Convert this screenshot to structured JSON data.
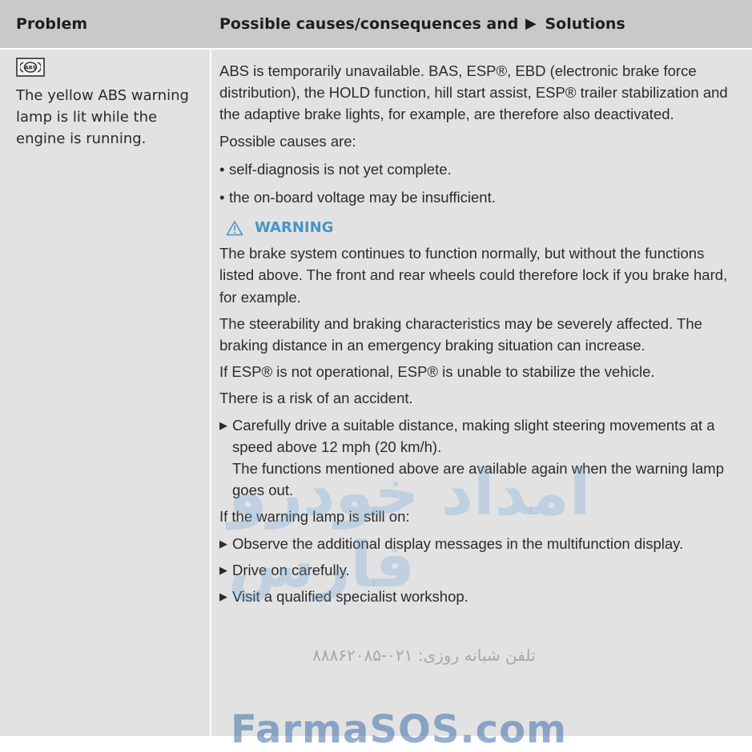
{
  "header": {
    "problem": "Problem",
    "solutions_prefix": "Possible causes/consequences and",
    "solutions_suffix": "Solutions"
  },
  "icon": {
    "name": "abs-warning-icon",
    "text": "ABS"
  },
  "problem_text": "The yellow ABS warning lamp is lit while the engine is running.",
  "content": {
    "p1": "ABS is temporarily unavailable. BAS, ESP®, EBD (electronic brake force distribution), the HOLD function, hill start assist, ESP® trailer stabilization and the adaptive brake lights, for example, are therefore also deactivated.",
    "p2": "Possible causes are:",
    "bullets": [
      "self-diagnosis is not yet complete.",
      "the on-board voltage may be insufficient."
    ],
    "warning_title": "WARNING",
    "w1": "The brake system continues to function normally, but without the functions listed above. The front and rear wheels could therefore lock if you brake hard, for example.",
    "w2": "The steerability and braking characteristics may be severely affected. The braking distance in an emergency braking situation can increase.",
    "w3": "If ESP® is not operational, ESP® is unable to stabilize the vehicle.",
    "w4": "There is a risk of an accident.",
    "step1": "Carefully drive a suitable distance, making slight steering movements at a speed above 12 mph (20 km/h).",
    "step1_sub": "The functions mentioned above are available again when the warning lamp goes out.",
    "p3": "If the warning lamp is still on:",
    "steps": [
      "Observe the additional display messages in the multifunction display.",
      "Drive on carefully.",
      "Visit a qualified specialist workshop."
    ]
  },
  "watermark": {
    "logo_text": "امداد خودرو فارس",
    "phone_line": "تلفن شبانه روزی: ۰۲۱-۸۸۸۶۲۰۸۵",
    "site": "FarmaSOS.com"
  },
  "colors": {
    "header_bg": "#c9c9c9",
    "row_bg": "#e2e2e2",
    "warning_accent": "#4a93c6"
  }
}
